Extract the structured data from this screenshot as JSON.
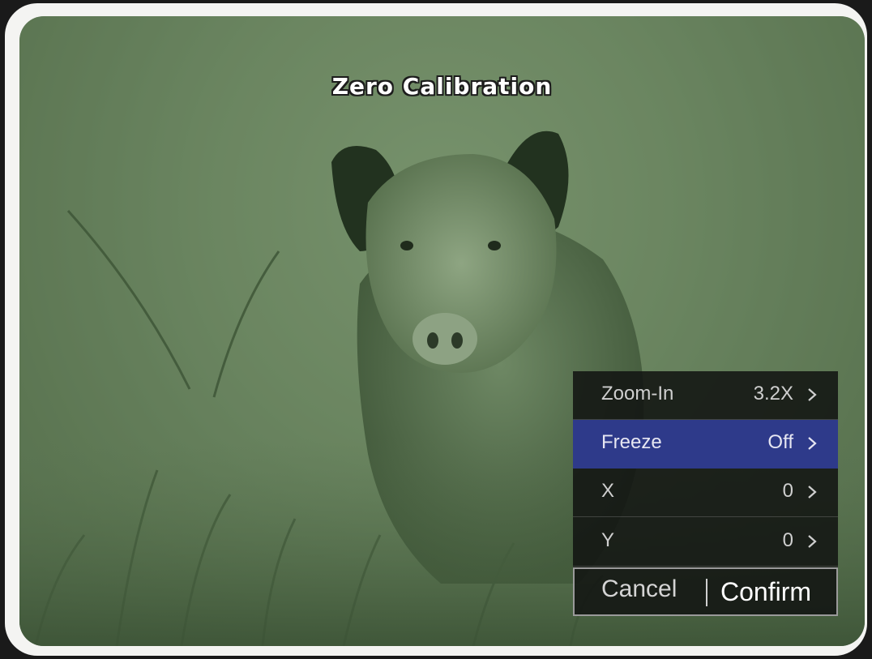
{
  "screen": {
    "title": "Zero Calibration"
  },
  "menu": {
    "rows": [
      {
        "label": "Zoom-In",
        "value": "3.2X",
        "selected": false
      },
      {
        "label": "Freeze",
        "value": "Off",
        "selected": true
      },
      {
        "label": "X",
        "value": "0",
        "selected": false
      },
      {
        "label": "Y",
        "value": "0",
        "selected": false
      }
    ],
    "cancel_label": "Cancel",
    "confirm_label": "Confirm"
  },
  "colors": {
    "highlight": "#2e3a8a",
    "panel_background": "#121412",
    "scene_tint": "#6b8660"
  },
  "icons": {
    "row_chevron": "chevron-right-icon"
  }
}
